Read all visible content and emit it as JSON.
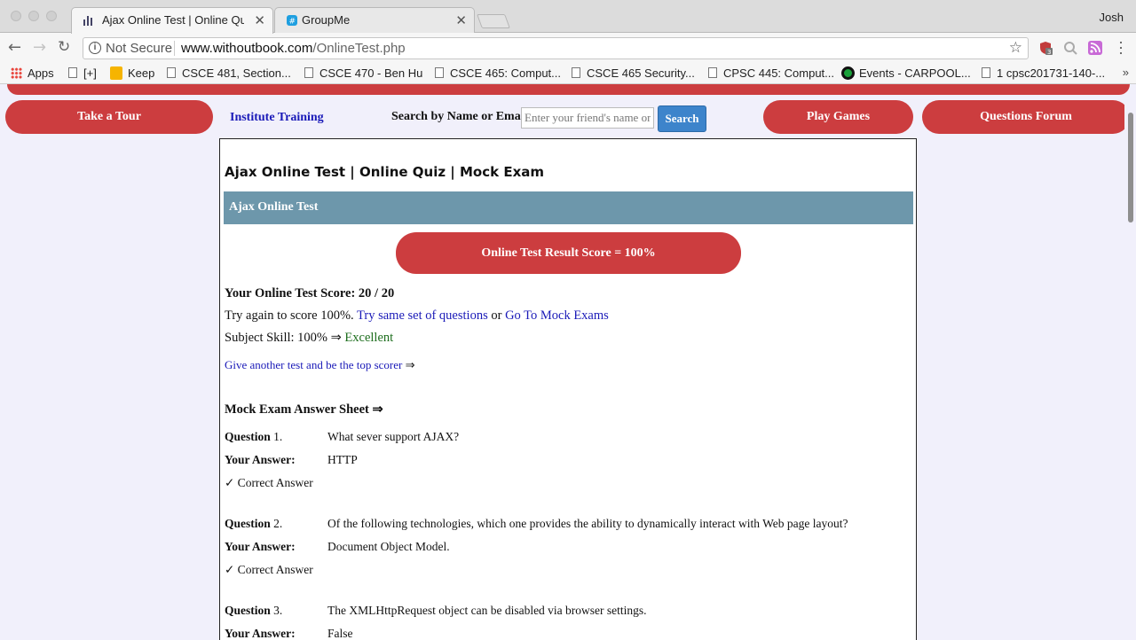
{
  "browser": {
    "tabs": [
      {
        "title": "Ajax Online Test | Online Quiz | Mock Exam",
        "active": true
      },
      {
        "title": "GroupMe",
        "active": false
      }
    ],
    "profile": "Josh",
    "omnibox": {
      "security": "Not Secure",
      "domain": "www.withoutbook.com",
      "path": "/OnlineTest.php"
    },
    "bookmarks": [
      "Apps",
      "[+]",
      "Keep",
      "CSCE 481, Section...",
      "CSCE 470 - Ben Hu",
      "CSCE 465: Comput...",
      "CSCE 465 Security...",
      "CPSC 445: Comput...",
      "Events - CARPOOL...",
      "1 cpsc201731-140-..."
    ],
    "extension_badge": "3"
  },
  "nav": {
    "take_tour": "Take a Tour",
    "institute_training": "Institute Training",
    "search_label": "Search by Name or Email",
    "search_placeholder": "Enter your friend's name or email",
    "search_button": "Search",
    "play_games": "Play Games",
    "questions_forum": "Questions Forum"
  },
  "main": {
    "page_title": "Ajax Online Test | Online Quiz | Mock Exam",
    "section_bar": "Ajax Online Test",
    "result_pill": "Online Test Result Score = 100%",
    "score_label": "Your Online Test Score: 20 / 20",
    "try_again_text": "Try again to score 100%.",
    "try_same_link": "Try same set of questions",
    "or_text": "or",
    "mock_exams_link": "Go To Mock Exams",
    "skill_text": "Subject Skill: 100% ⇒",
    "skill_level": "Excellent",
    "another_test_link": "Give another test and be the top scorer",
    "arrow": "⇒",
    "answer_sheet_title": "Mock Exam Answer Sheet ⇒",
    "question_label": "Question",
    "your_answer_label": "Your Answer:",
    "correct_text": "✓ Correct Answer",
    "questions": [
      {
        "number": "1.",
        "text": "What sever support AJAX?",
        "answer": "HTTP"
      },
      {
        "number": "2.",
        "text": "Of the following technologies, which one provides the ability to dynamically interact with Web page layout?",
        "answer": "Document Object Model."
      },
      {
        "number": "3.",
        "text": "The XMLHttpRequest object can be disabled via browser settings.",
        "answer": "False"
      }
    ]
  }
}
